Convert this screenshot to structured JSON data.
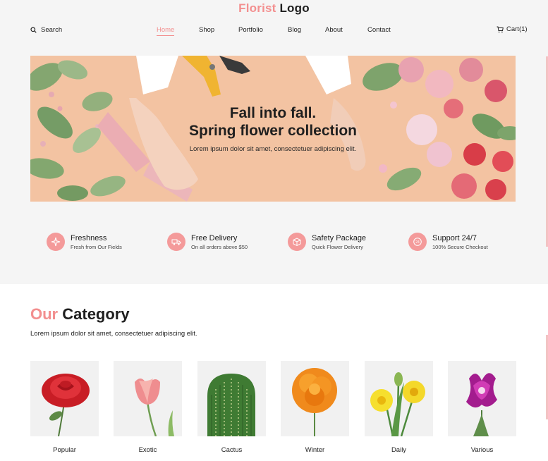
{
  "logo": {
    "accent": "Florist",
    "text": "Logo"
  },
  "header": {
    "search_label": "Search",
    "nav": [
      {
        "label": "Home",
        "active": true
      },
      {
        "label": "Shop",
        "active": false
      },
      {
        "label": "Portfolio",
        "active": false
      },
      {
        "label": "Blog",
        "active": false
      },
      {
        "label": "About",
        "active": false
      },
      {
        "label": "Contact",
        "active": false
      }
    ],
    "cart_label": "Cart(1)"
  },
  "hero": {
    "title_line1": "Fall into fall.",
    "title_line2": "Spring flower collection",
    "subtitle": "Lorem ipsum dolor sit amet, consectetuer adipiscing elit."
  },
  "features": [
    {
      "title": "Freshness",
      "subtitle": "Fresh from Our Fields",
      "icon": "sparkle-icon"
    },
    {
      "title": "Free Delivery",
      "subtitle": "On all orders above $50",
      "icon": "truck-icon"
    },
    {
      "title": "Safety Package",
      "subtitle": "Quick Flower Delivery",
      "icon": "box-icon"
    },
    {
      "title": "Support 24/7",
      "subtitle": "100% Secure Checkout",
      "icon": "support-icon"
    }
  ],
  "category": {
    "heading_accent": "Our",
    "heading_text": "Category",
    "description": "Lorem ipsum dolor sit amet, consectetuer adipiscing elit.",
    "items": [
      {
        "label": "Popular",
        "flower": "red-rose"
      },
      {
        "label": "Exotic",
        "flower": "pink-tulip"
      },
      {
        "label": "Cactus",
        "flower": "cactus"
      },
      {
        "label": "Winter",
        "flower": "orange-marigold"
      },
      {
        "label": "Daily",
        "flower": "yellow-daffodil"
      },
      {
        "label": "Various",
        "flower": "purple-orchid"
      }
    ]
  },
  "colors": {
    "accent": "#f38f8f",
    "hero_bg": "#f3c3a2",
    "top_bg": "#f5f5f5"
  }
}
